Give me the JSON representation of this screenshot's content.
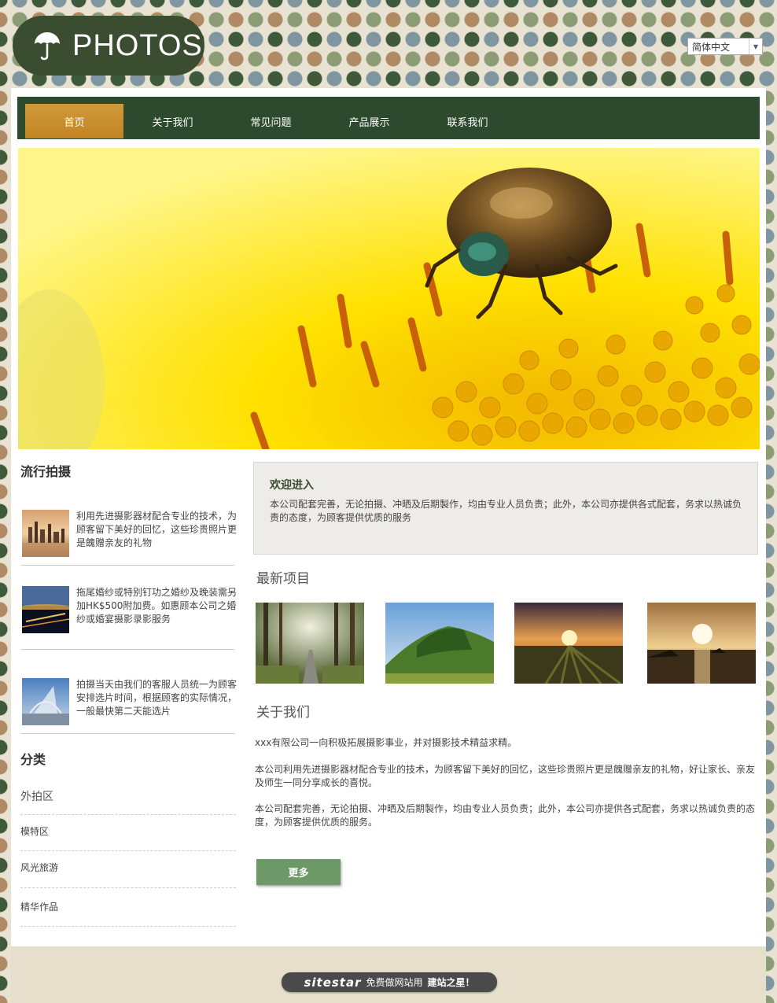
{
  "header": {
    "logo_text": "PHOTOS",
    "language": "简体中文"
  },
  "nav": {
    "items": [
      "首页",
      "关于我们",
      "常见问题",
      "产品展示",
      "联系我们"
    ],
    "active_index": 0
  },
  "sidebar": {
    "popular_title": "流行拍摄",
    "popular_items": [
      "利用先进摄影器材配合专业的技术，为顾客留下美好的回忆，这些珍贵照片更是餽赠亲友的礼物",
      "拖尾婚纱或特别钉功之婚纱及晚装需另加HK$500附加费。如惠顾本公司之婚纱或婚宴摄影录影服务",
      "拍摄当天由我们的客服人员统一为顾客安排选片时间，根据顾客的实际情况，一般最快第二天能选片"
    ],
    "category_title": "分类",
    "categories": [
      "外拍区",
      "模特区",
      "风光旅游",
      "精华作品"
    ]
  },
  "welcome": {
    "title": "欢迎进入",
    "text": "本公司配套完善，无论拍摄、冲晒及后期製作，均由专业人员负责；此外，本公司亦提供各式配套，务求以热诚负责的态度，为顾客提供优质的服务"
  },
  "latest": {
    "title": "最新项目"
  },
  "about": {
    "title": "关于我们",
    "paragraphs": [
      "xxx有限公司一向积极拓展摄影事业，并对摄影技术精益求精。",
      "本公司利用先进摄影器材配合专业的技术，为顾客留下美好的回忆，这些珍贵照片更是餽赠亲友的礼物，好让家长、亲友及师生一同分享成长的喜悦。",
      "本公司配套完善，无论拍摄、冲晒及后期製作，均由专业人员负责；此外，本公司亦提供各式配套，务求以热诚负责的态度，为顾客提供优质的服务。"
    ],
    "more_label": "更多"
  },
  "footer": {
    "brand": "sitestar",
    "slogan": "免费做网站用",
    "slogan_bold": "建站之星！"
  },
  "colors": {
    "nav_bg": "#2e4a2e",
    "nav_active": "#c8902e",
    "button": "#6d9868",
    "logo_bg": "#3b4d30",
    "footer_bg": "#e5dfcc"
  }
}
